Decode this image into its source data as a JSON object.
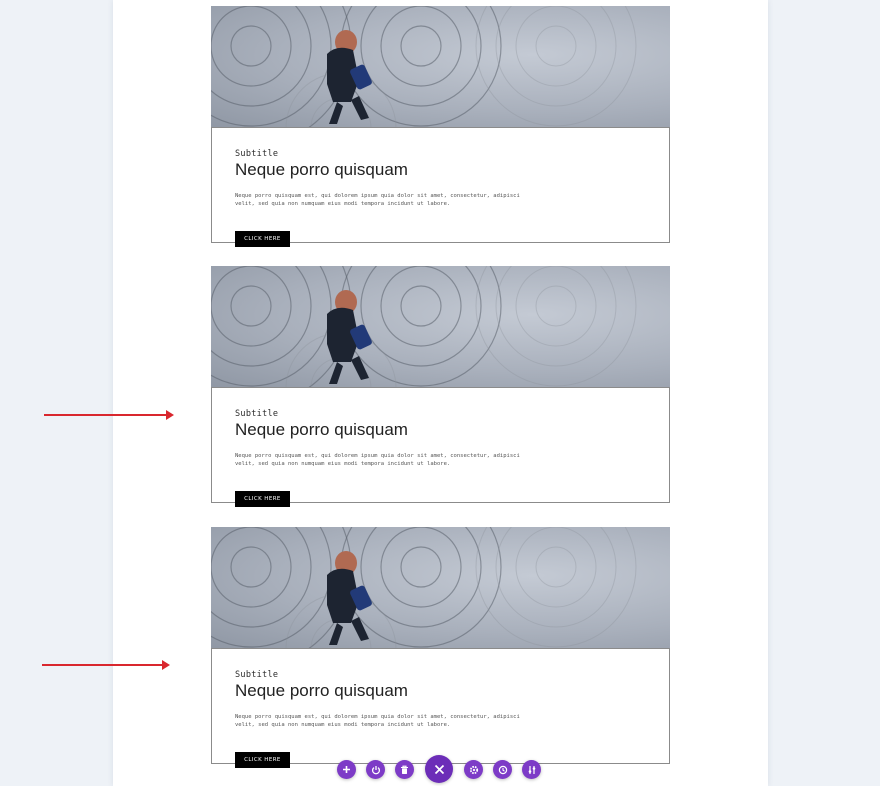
{
  "cards": [
    {
      "subtitle": "Subtitle",
      "title": "Neque porro quisquam",
      "body": "Neque porro quisquam est, qui dolorem ipsum quia dolor sit amet, consectetur, adipisci velit, sed quia non numquam eius modi tempora incidunt ut labore.",
      "button_label": "CLICK HERE"
    },
    {
      "subtitle": "Subtitle",
      "title": "Neque porro quisquam",
      "body": "Neque porro quisquam est, qui dolorem ipsum quia dolor sit amet, consectetur, adipisci velit, sed quia non numquam eius modi tempora incidunt ut labore.",
      "button_label": "CLICK HERE"
    },
    {
      "subtitle": "Subtitle",
      "title": "Neque porro quisquam",
      "body": "Neque porro quisquam est, qui dolorem ipsum quia dolor sit amet, consectetur, adipisci velit, sed quia non numquam eius modi tempora incidunt ut labore.",
      "button_label": "CLICK HERE"
    }
  ],
  "annotation_color": "#d9272e",
  "toolbar": {
    "accent": "#7d3bc7",
    "buttons": [
      "add-icon",
      "power-icon",
      "trash-icon",
      "close-icon",
      "gear-icon",
      "history-icon",
      "sliders-icon"
    ]
  }
}
